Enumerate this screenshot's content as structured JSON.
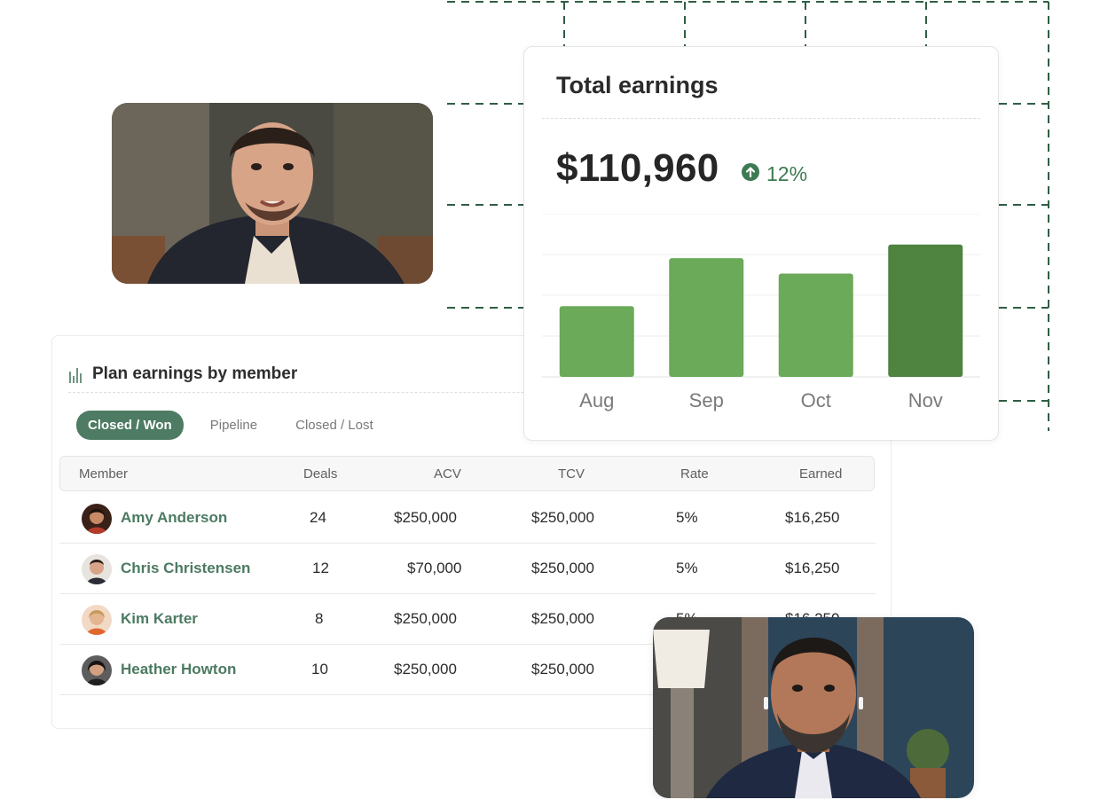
{
  "colors": {
    "accent": "#4e7b63",
    "bar": "#6aaa58",
    "bar_highlight": "#4e8340",
    "up": "#3d7a52",
    "deco_dash": "#2f5e44"
  },
  "photos": [
    {
      "name": "photo-top",
      "subject": "smiling man in dark blazer"
    },
    {
      "name": "photo-bottom",
      "subject": "bearded man with earbuds in navy jacket"
    }
  ],
  "plan": {
    "title": "Plan earnings by member",
    "icon": "bar-chart-icon",
    "tabs": [
      {
        "label": "Closed / Won",
        "active": true
      },
      {
        "label": "Pipeline",
        "active": false
      },
      {
        "label": "Closed / Lost",
        "active": false
      }
    ],
    "columns": [
      "Member",
      "Deals",
      "ACV",
      "TCV",
      "Rate",
      "Earned"
    ],
    "rows": [
      {
        "member": "Amy Anderson",
        "deals": "24",
        "acv": "$250,000",
        "tcv": "$250,000",
        "rate": "5%",
        "earned": "$16,250"
      },
      {
        "member": "Chris Christensen",
        "deals": "12",
        "acv": "$70,000",
        "tcv": "$250,000",
        "rate": "5%",
        "earned": "$16,250"
      },
      {
        "member": "Kim Karter",
        "deals": "8",
        "acv": "$250,000",
        "tcv": "$250,000",
        "rate": "5%",
        "earned": "$16,250"
      },
      {
        "member": "Heather Howton",
        "deals": "10",
        "acv": "$250,000",
        "tcv": "$250,000",
        "rate": "",
        "earned": ""
      }
    ]
  },
  "earnings": {
    "title": "Total earnings",
    "amount": "$110,960",
    "change": "12%",
    "change_icon": "arrow-up-circle-icon"
  },
  "chart_data": {
    "type": "bar",
    "categories": [
      "Aug",
      "Sep",
      "Oct",
      "Nov"
    ],
    "values": [
      78,
      131,
      114,
      146
    ],
    "highlight_index": 3,
    "ylim": [
      0,
      180
    ],
    "grid": true,
    "title": "",
    "xlabel": "",
    "ylabel": ""
  }
}
